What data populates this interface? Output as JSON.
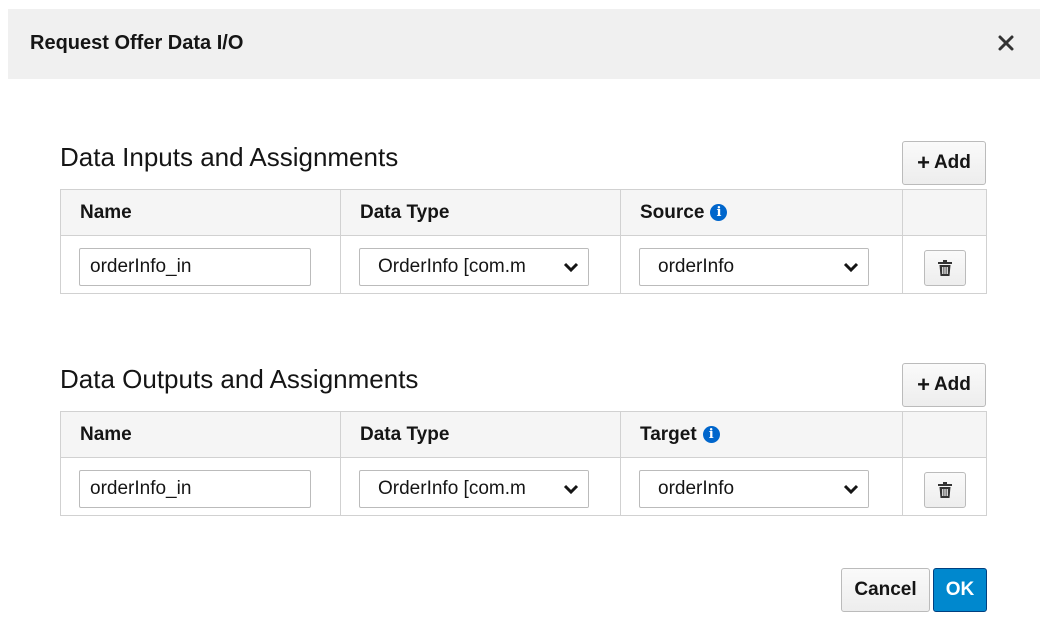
{
  "dialog": {
    "title": "Request Offer Data I/O"
  },
  "inputs": {
    "title": "Data Inputs and Assignments",
    "add_label": "Add",
    "columns": {
      "name": "Name",
      "data_type": "Data Type",
      "source": "Source"
    },
    "row": {
      "name": "orderInfo_in",
      "data_type": "OrderInfo [com.m",
      "source": "orderInfo"
    }
  },
  "outputs": {
    "title": "Data Outputs and Assignments",
    "add_label": "Add",
    "columns": {
      "name": "Name",
      "data_type": "Data Type",
      "target": "Target"
    },
    "row": {
      "name": "orderInfo_in",
      "data_type": "OrderInfo [com.m",
      "target": "orderInfo"
    }
  },
  "footer": {
    "cancel_label": "Cancel",
    "ok_label": "OK"
  },
  "colors": {
    "primary": "#0088ce",
    "info_icon": "#0066cc",
    "header_bg": "#f0f0f0"
  },
  "icons": {
    "close": "close-icon",
    "add": "plus-icon",
    "info": "info-icon",
    "select": "chevron-down-icon",
    "delete": "trash-icon"
  }
}
